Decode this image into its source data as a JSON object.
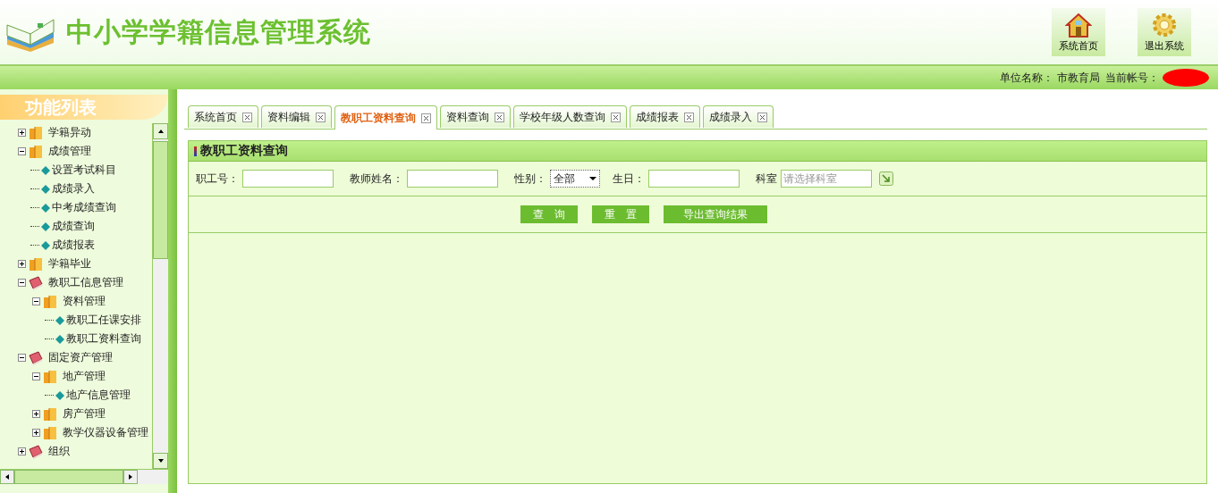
{
  "header": {
    "title": "中小学学籍信息管理系统",
    "actions": [
      {
        "kind": "home",
        "label": "系统首页"
      },
      {
        "kind": "exit",
        "label": "退出系统"
      }
    ]
  },
  "info_bar": {
    "unit_label": "单位名称：",
    "unit": "市教育局",
    "account_label": "当前帐号："
  },
  "sidebar": {
    "title": "功能列表",
    "tree": [
      {
        "label": "学籍异动",
        "kind": "folder",
        "expanded": false
      },
      {
        "label": "成绩管理",
        "kind": "folder",
        "expanded": true,
        "children": [
          {
            "label": "设置考试科目",
            "kind": "leaf"
          },
          {
            "label": "成绩录入",
            "kind": "leaf"
          },
          {
            "label": "中考成绩查询",
            "kind": "leaf"
          },
          {
            "label": "成绩查询",
            "kind": "leaf"
          },
          {
            "label": "成绩报表",
            "kind": "leaf"
          }
        ]
      },
      {
        "label": "学籍毕业",
        "kind": "folder",
        "expanded": false
      },
      {
        "label": "教职工信息管理",
        "kind": "book",
        "expanded": true,
        "children": [
          {
            "label": "资料管理",
            "kind": "folder",
            "expanded": true,
            "children": [
              {
                "label": "教职工任课安排",
                "kind": "leaf"
              },
              {
                "label": "教职工资料查询",
                "kind": "leaf"
              }
            ]
          }
        ]
      },
      {
        "label": "固定资产管理",
        "kind": "book",
        "expanded": true,
        "children": [
          {
            "label": "地产管理",
            "kind": "folder",
            "expanded": true,
            "children": [
              {
                "label": "地产信息管理",
                "kind": "leaf"
              }
            ]
          },
          {
            "label": "房产管理",
            "kind": "folder",
            "expanded": false
          },
          {
            "label": "教学仪器设备管理",
            "kind": "folder",
            "expanded": false
          }
        ]
      },
      {
        "label": "组织",
        "kind": "book",
        "expanded": false
      }
    ]
  },
  "tabs": [
    {
      "label": "系统首页",
      "selected": false
    },
    {
      "label": "资料编辑",
      "selected": false
    },
    {
      "label": "教职工资料查询",
      "selected": true
    },
    {
      "label": "资料查询",
      "selected": false
    },
    {
      "label": "学校年级人数查询",
      "selected": false
    },
    {
      "label": "成绩报表",
      "selected": false
    },
    {
      "label": "成绩录入",
      "selected": false
    }
  ],
  "panel": {
    "title": "教职工资料查询",
    "fields": [
      {
        "label": "职工号：",
        "kind": "text"
      },
      {
        "label": "教师姓名：",
        "kind": "text"
      },
      {
        "label": "性别：",
        "kind": "select",
        "value": "全部"
      },
      {
        "label": "生日：",
        "kind": "text"
      },
      {
        "label": "科室",
        "kind": "picker",
        "placeholder": "请选择科室"
      }
    ],
    "buttons": [
      "查　询",
      "重　置",
      "导出查询结果"
    ]
  }
}
